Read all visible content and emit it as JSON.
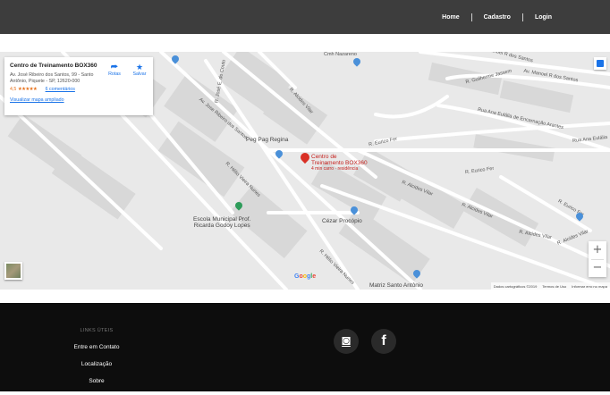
{
  "header": {
    "nav": [
      {
        "label": "Home"
      },
      {
        "label": "Cadastro"
      },
      {
        "label": "Login"
      }
    ]
  },
  "map": {
    "place_card": {
      "title": "Centro de Treinamento BOX360",
      "address": "Av. José Ribeiro dos Santos, 99 - Santo Antônio, Piquete - SP, 12620-000",
      "rating": "4,5",
      "stars": "★★★★★",
      "reviews": "6 comentários",
      "view_larger": "Visualizar mapa ampliado",
      "directions_label": "Rotas",
      "save_label": "Salvar"
    },
    "pin": {
      "title_line1": "Centro de",
      "title_line2": "Treinamento BOX360",
      "subtitle": "4 min carro · residência"
    },
    "streets": [
      "Av. Manoel R dos Santos",
      "R. Guilherme Jassem",
      "Av. Manoel R dos Santos",
      "Rua Ana Eulália de Encarnação Arantes",
      "Rua Ana Eulália",
      "R. Eurico Fer",
      "R. Eurico Fer",
      "R. Alcides Vilar",
      "R. Alcides Vilar",
      "R. Alcides Vilar",
      "R. Alcides Vilar",
      "R. Eurico Fer",
      "R. José E. do Couto",
      "Av. Jose Ribeiro dos Santos",
      "R. Alcides Vilar",
      "R. Hélio Vieira Nunes",
      "R. Hélio Vieira Nunes",
      "Cmh Nazareno"
    ],
    "pois": {
      "peg_pag": "Peg Pag Regina",
      "escola_line1": "Escola Municipal Prof.",
      "escola_line2": "Ricarda Godoy Lopes",
      "cezar": "Cézar Procópio",
      "matriz": "Matriz Santo Antônio"
    },
    "zoom_in": "+",
    "zoom_out": "−",
    "google": [
      "G",
      "o",
      "o",
      "g",
      "l",
      "e"
    ],
    "attribution": [
      "Dados cartográficos ©2019",
      "Termos de Uso",
      "Informar erro no mapa"
    ]
  },
  "footer": {
    "links_heading": "LINKS ÚTEIS",
    "links": [
      {
        "label": "Entre em Contato"
      },
      {
        "label": "Localização"
      },
      {
        "label": "Sobre"
      }
    ],
    "social": [
      {
        "icon": "instagram-icon",
        "glyph": "◙"
      },
      {
        "icon": "facebook-icon",
        "glyph": "f"
      }
    ]
  }
}
